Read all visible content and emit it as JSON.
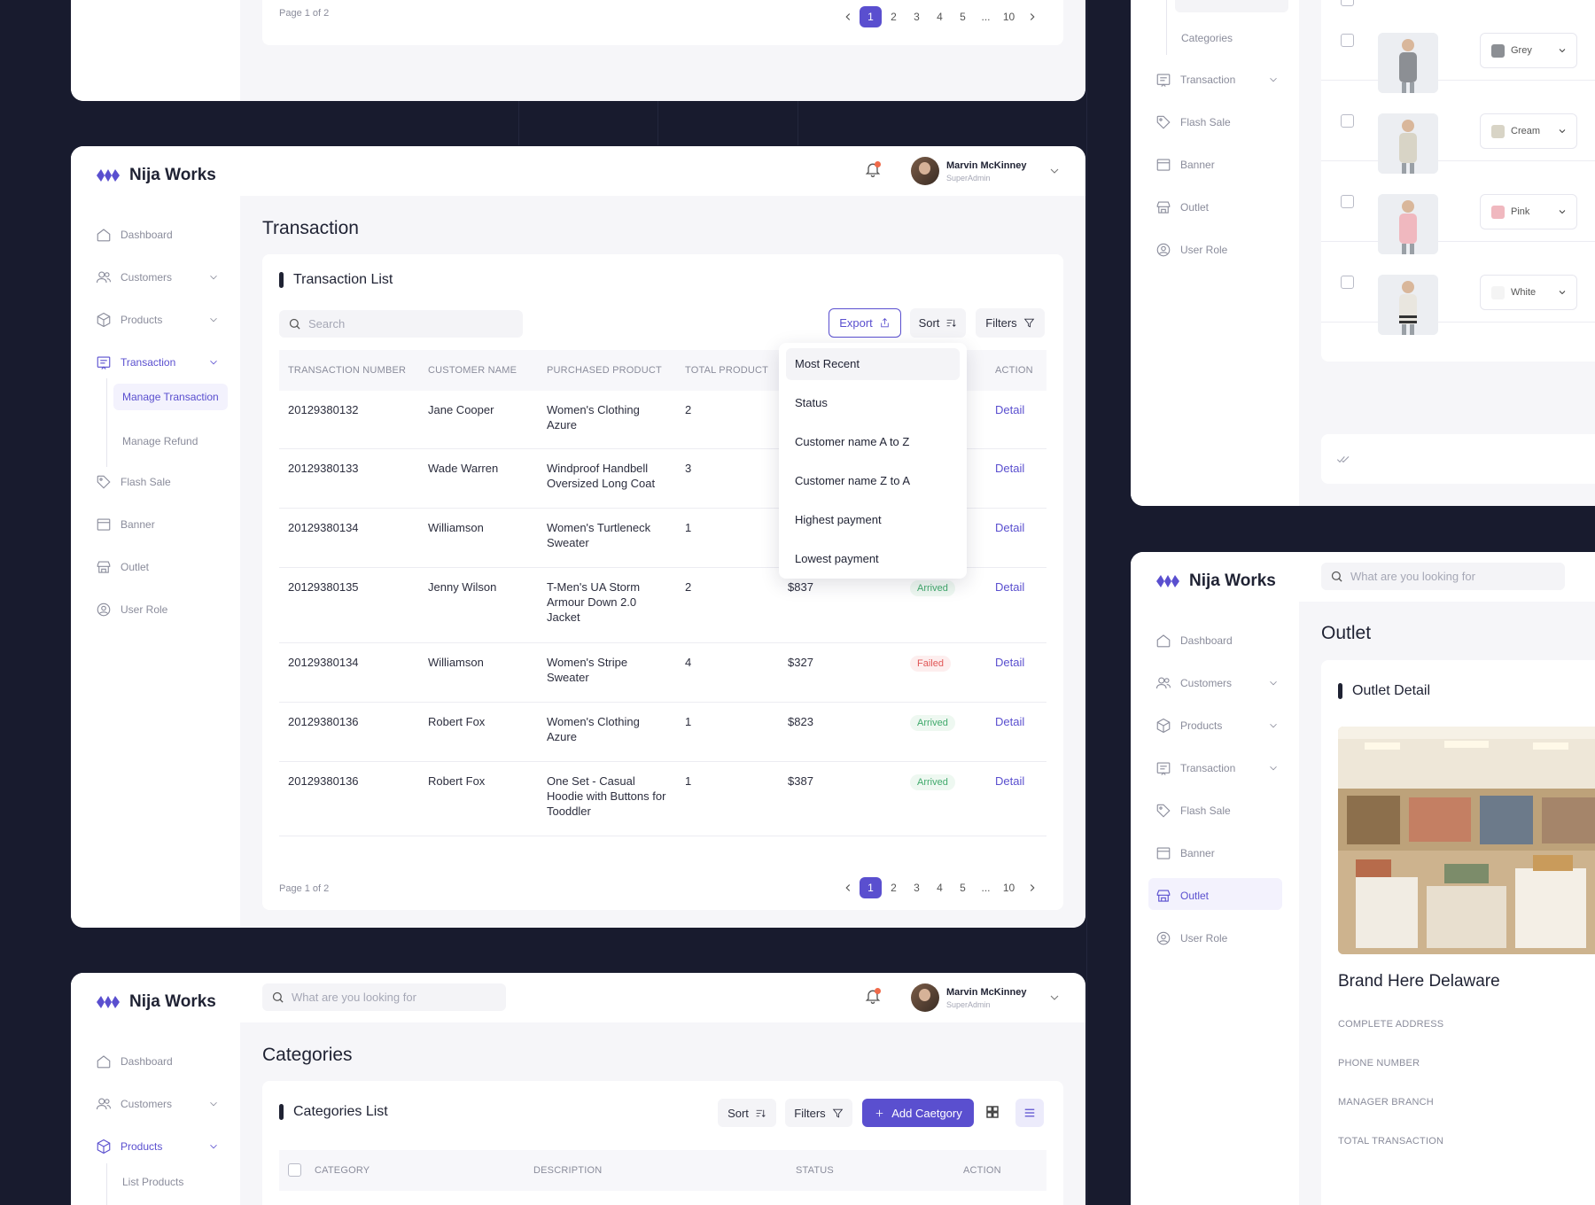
{
  "brand": {
    "name": "Nija Works"
  },
  "user": {
    "name": "Marvin McKinney",
    "role": "SuperAdmin"
  },
  "nav": {
    "dashboard": "Dashboard",
    "customers": "Customers",
    "products": "Products",
    "transaction": "Transaction",
    "manage_transaction": "Manage Transaction",
    "manage_refund": "Manage Refund",
    "flash_sale": "Flash Sale",
    "banner": "Banner",
    "outlet": "Outlet",
    "user_role": "User Role",
    "categories": "Categories",
    "list_products": "List Products"
  },
  "top_frame": {
    "page_text": "Page 1 of 2",
    "pages": [
      "1",
      "2",
      "3",
      "4",
      "5",
      "...",
      "10"
    ]
  },
  "transaction_page": {
    "title": "Transaction",
    "card_title": "Transaction List",
    "search_placeholder": "Search",
    "export": "Export",
    "sort": "Sort",
    "filters": "Filters",
    "columns": [
      "TRANSACTION NUMBER",
      "CUSTOMER NAME",
      "PURCHASED PRODUCT",
      "TOTAL PRODUCT",
      "ACTION"
    ],
    "rows": [
      {
        "number": "20129380132",
        "customer": "Jane Cooper",
        "product": "Women's Clothing Azure",
        "qty": "2",
        "price": "",
        "status": "",
        "status_type": "",
        "action": "Detail"
      },
      {
        "number": "20129380133",
        "customer": "Wade Warren",
        "product": "Windproof Handbell Oversized Long Coat",
        "qty": "3",
        "price": "",
        "status": "",
        "status_type": "",
        "action": "Detail"
      },
      {
        "number": "20129380134",
        "customer": "Williamson",
        "product": "Women's Turtleneck Sweater",
        "qty": "1",
        "price": "",
        "status": "",
        "status_type": "",
        "action": "Detail"
      },
      {
        "number": "20129380135",
        "customer": "Jenny Wilson",
        "product": "T-Men's UA Storm Armour Down 2.0 Jacket",
        "qty": "2",
        "price": "$837",
        "status": "Arrived",
        "status_type": "ok",
        "action": "Detail"
      },
      {
        "number": "20129380134",
        "customer": "Williamson",
        "product": "Women's Stripe Sweater",
        "qty": "4",
        "price": "$327",
        "status": "Failed",
        "status_type": "fail",
        "action": "Detail"
      },
      {
        "number": "20129380136",
        "customer": "Robert Fox",
        "product": "Women's Clothing Azure",
        "qty": "1",
        "price": "$823",
        "status": "Arrived",
        "status_type": "ok",
        "action": "Detail"
      },
      {
        "number": "20129380136",
        "customer": "Robert Fox",
        "product": "One Set - Casual Hoodie with Buttons for Tooddler",
        "qty": "1",
        "price": "$387",
        "status": "Arrived",
        "status_type": "ok",
        "action": "Detail"
      }
    ],
    "sort_menu": [
      "Most Recent",
      "Status",
      "Customer name A to Z",
      "Customer name Z to A",
      "Highest payment",
      "Lowest payment"
    ],
    "page_text": "Page 1 of 2",
    "pages": [
      "1",
      "2",
      "3",
      "4",
      "5",
      "...",
      "10"
    ]
  },
  "categories_page": {
    "search_placeholder": "What are you looking for",
    "title": "Categories",
    "card_title": "Categories List",
    "sort": "Sort",
    "filters": "Filters",
    "add": "Add Caetgory",
    "columns": [
      "CATEGORY",
      "DESCRIPTION",
      "STATUS",
      "ACTION"
    ]
  },
  "product_colors": {
    "items": [
      {
        "name": "Grey",
        "color": "#8c8f94"
      },
      {
        "name": "Cream",
        "color": "#d8d4c6"
      },
      {
        "name": "Pink",
        "color": "#f0b8bf"
      },
      {
        "name": "White",
        "color": "#f4f4f4"
      }
    ]
  },
  "outlet_page": {
    "search_placeholder": "What are you looking for",
    "title": "Outlet",
    "card_title": "Outlet Detail",
    "store_name": "Brand Here Delaware",
    "labels": [
      "COMPLETE ADDRESS",
      "PHONE NUMBER",
      "MANAGER BRANCH",
      "TOTAL TRANSACTION"
    ]
  },
  "colors": {
    "accent": "#5a4fcf",
    "success": "#3fa96b",
    "danger": "#e15656",
    "background": "#181b2e"
  }
}
